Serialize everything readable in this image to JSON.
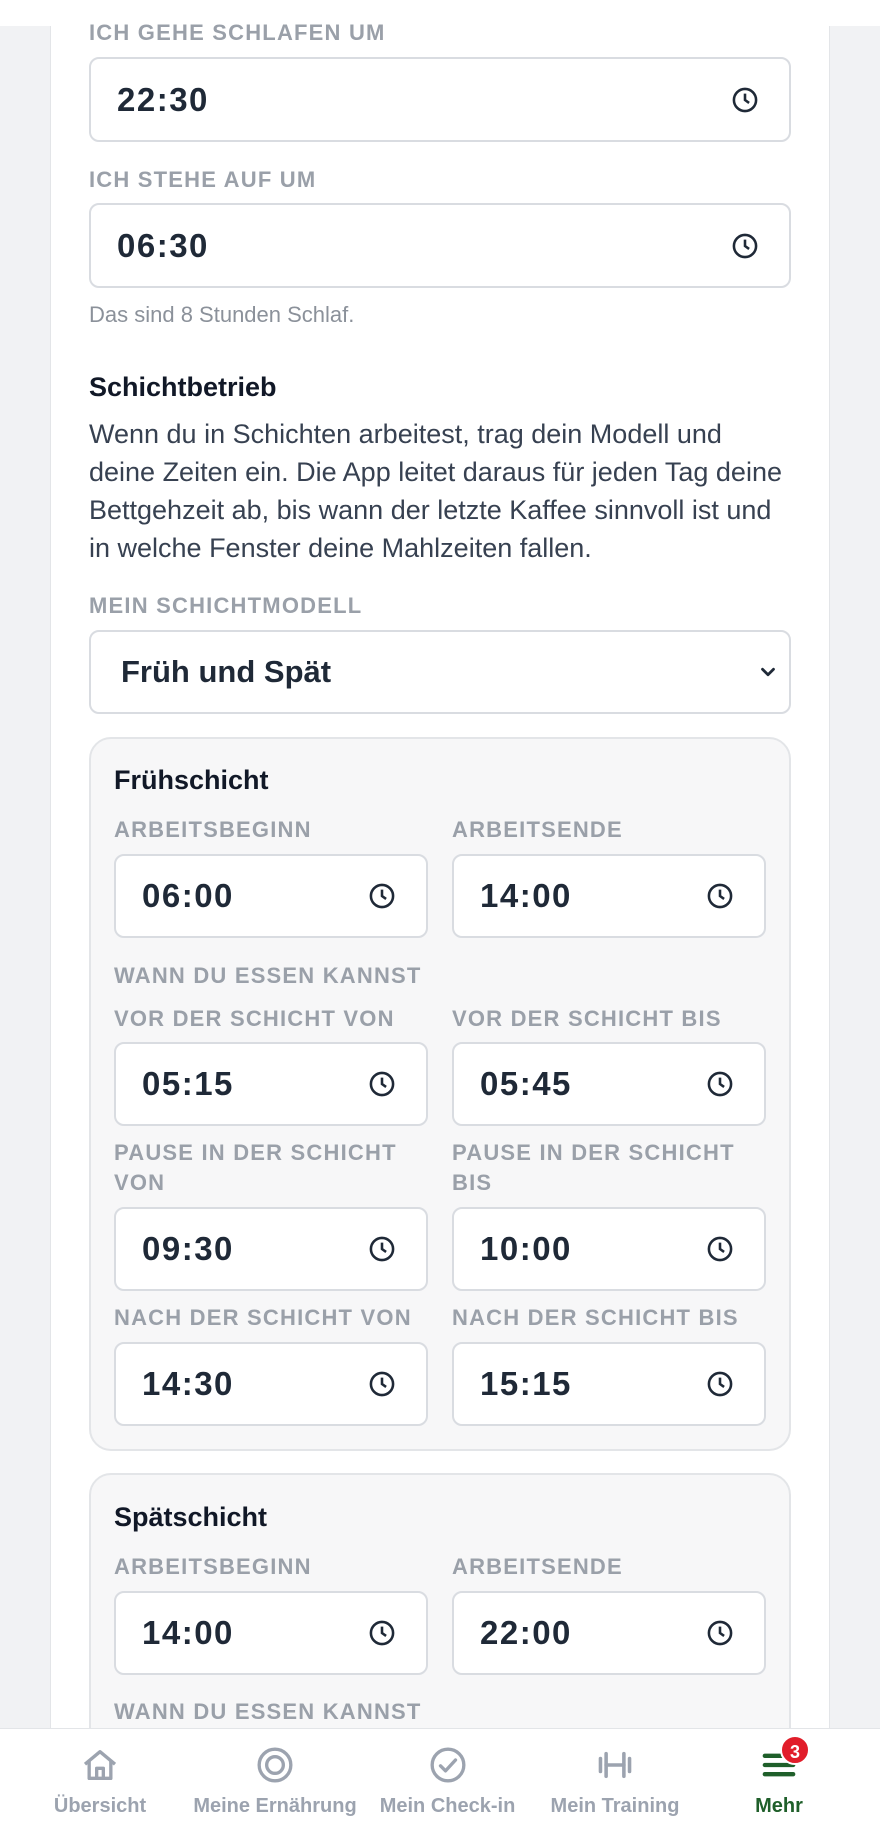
{
  "sleep": {
    "bedtime_label": "ICH GEHE SCHLAFEN UM",
    "bedtime_value": "22:30",
    "wake_label": "ICH STEHE AUF UM",
    "wake_value": "06:30",
    "summary": "Das sind 8 Stunden Schlaf."
  },
  "shift": {
    "heading": "Schichtbetrieb",
    "description": "Wenn du in Schichten arbeitest, trag dein Modell und deine Zeiten ein. Die App leitet daraus für jeden Tag deine Bettgehzeit ab, bis wann der letzte Kaffee sinnvoll ist und in welche Fenster deine Mahlzeiten fallen.",
    "model_label": "MEIN SCHICHTMODELL",
    "model_value": "Früh und Spät",
    "early": {
      "title": "Frühschicht",
      "start_label": "ARBEITSBEGINN",
      "start_value": "06:00",
      "end_label": "ARBEITSENDE",
      "end_value": "14:00",
      "eat_label": "WANN DU ESSEN KANNST",
      "before_from_label": "VOR DER SCHICHT VON",
      "before_from_value": "05:15",
      "before_to_label": "VOR DER SCHICHT BIS",
      "before_to_value": "05:45",
      "pause_from_label": "PAUSE IN DER SCHICHT VON",
      "pause_from_value": "09:30",
      "pause_to_label": "PAUSE IN DER SCHICHT BIS",
      "pause_to_value": "10:00",
      "after_from_label": "NACH DER SCHICHT VON",
      "after_from_value": "14:30",
      "after_to_label": "NACH DER SCHICHT BIS",
      "after_to_value": "15:15"
    },
    "late": {
      "title": "Spätschicht",
      "start_label": "ARBEITSBEGINN",
      "start_value": "14:00",
      "end_label": "ARBEITSENDE",
      "end_value": "22:00",
      "eat_label": "WANN DU ESSEN KANNST"
    }
  },
  "nav": {
    "items": [
      {
        "label": "Übersicht",
        "icon": "home-icon"
      },
      {
        "label": "Meine Ernährung",
        "icon": "target-icon"
      },
      {
        "label": "Mein Check-in",
        "icon": "check-circle-icon"
      },
      {
        "label": "Mein Training",
        "icon": "dumbbell-icon"
      },
      {
        "label": "Mehr",
        "icon": "menu-icon",
        "badge": "3",
        "active": true
      }
    ]
  },
  "colors": {
    "active_nav": "#1f5f2a",
    "badge": "#e11d2a",
    "label_grey": "#9aa0a9"
  }
}
